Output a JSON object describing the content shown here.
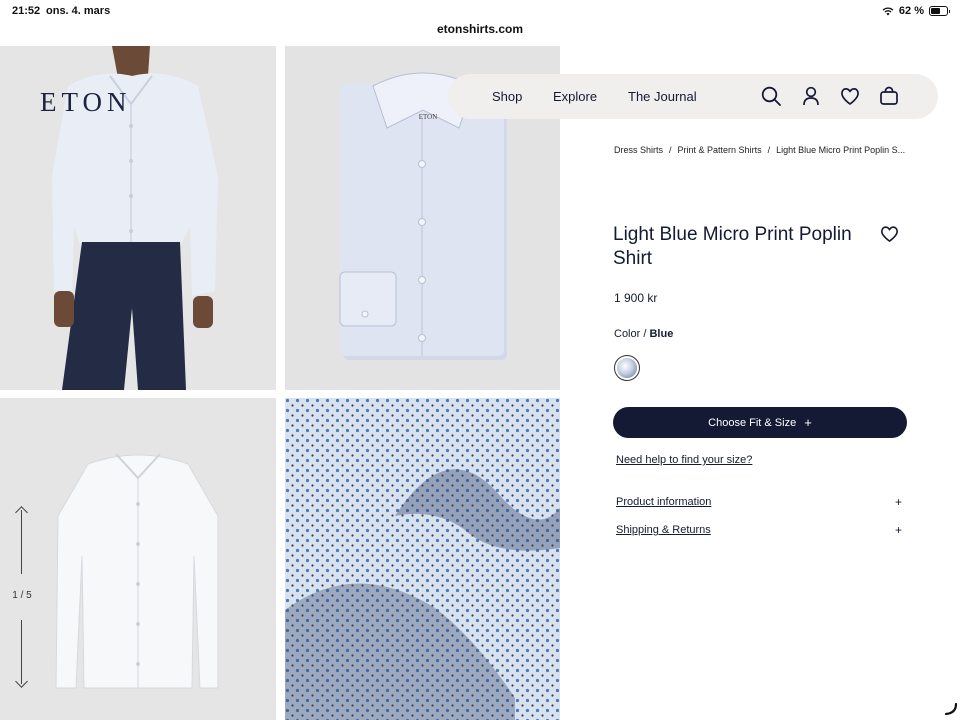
{
  "status_bar": {
    "time": "21:52",
    "date": "ons. 4. mars",
    "battery_text": "62 %",
    "battery_level": 0.62
  },
  "browser": {
    "url": "etonshirts.com"
  },
  "brand": {
    "logo": "ETON",
    "shirt_label": "ETON"
  },
  "gallery": {
    "counter": "1 / 5"
  },
  "nav": {
    "items": [
      "Shop",
      "Explore",
      "The Journal"
    ],
    "icons": [
      "search-icon",
      "account-icon",
      "heart-icon",
      "bag-icon"
    ]
  },
  "breadcrumb": [
    "Dress Shirts",
    "Print & Pattern Shirts",
    "Light Blue Micro Print Poplin S..."
  ],
  "product": {
    "title": "Light Blue Micro Print Poplin Shirt",
    "price": "1 900 kr",
    "color_label": "Color",
    "color_separator": "/",
    "color_value": "Blue",
    "cta_label": "Choose Fit & Size",
    "cta_plus": "+",
    "help_link": "Need help to find your size?",
    "accordions": [
      {
        "label": "Product information",
        "toggle": "+"
      },
      {
        "label": "Shipping & Returns",
        "toggle": "+"
      }
    ]
  },
  "colors": {
    "brand_navy": "#141a33",
    "nav_bg": "#f0efed",
    "fabric_blue": "#c4d4e6"
  }
}
